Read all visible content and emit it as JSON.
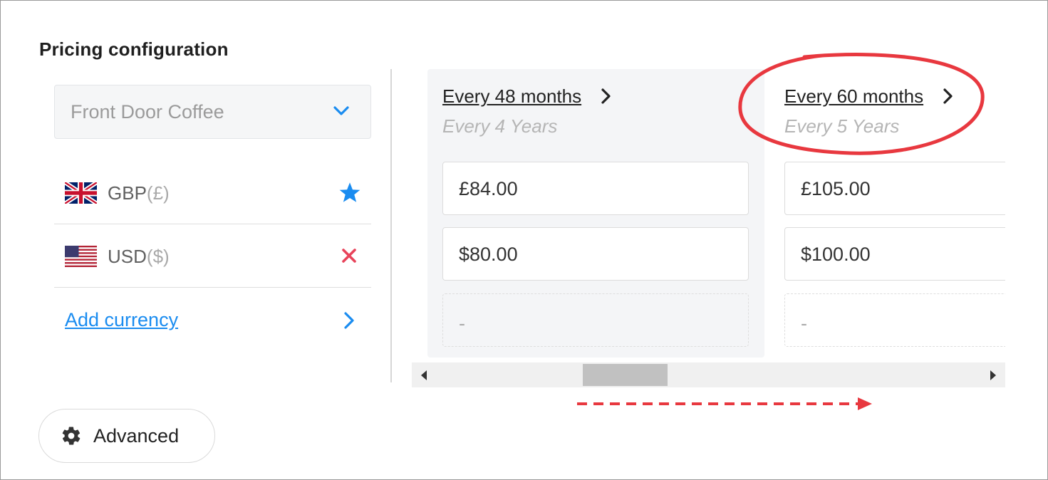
{
  "title": "Pricing configuration",
  "product_select": {
    "value": "Front Door Coffee",
    "icon": "chevron-down-icon"
  },
  "currencies": [
    {
      "code": "GBP",
      "symbol": "(£)",
      "flag": "uk-flag-icon",
      "action": "star-icon"
    },
    {
      "code": "USD",
      "symbol": "($)",
      "flag": "us-flag-icon",
      "action": "close-icon"
    }
  ],
  "add_currency_label": "Add currency",
  "columns": [
    {
      "period": "Every 48 months",
      "subtitle": "Every 4 Years",
      "prices": [
        "£84.00",
        "$80.00"
      ],
      "empty": "-"
    },
    {
      "period": "Every 60 months",
      "subtitle": "Every 5 Years",
      "prices": [
        "£105.00",
        "$100.00"
      ],
      "empty": "-"
    }
  ],
  "advanced_label": "Advanced",
  "colors": {
    "accent": "#1a8cf0",
    "remove": "#e8435a",
    "annotation": "#e8383f",
    "column_bg": "#f4f5f7"
  }
}
